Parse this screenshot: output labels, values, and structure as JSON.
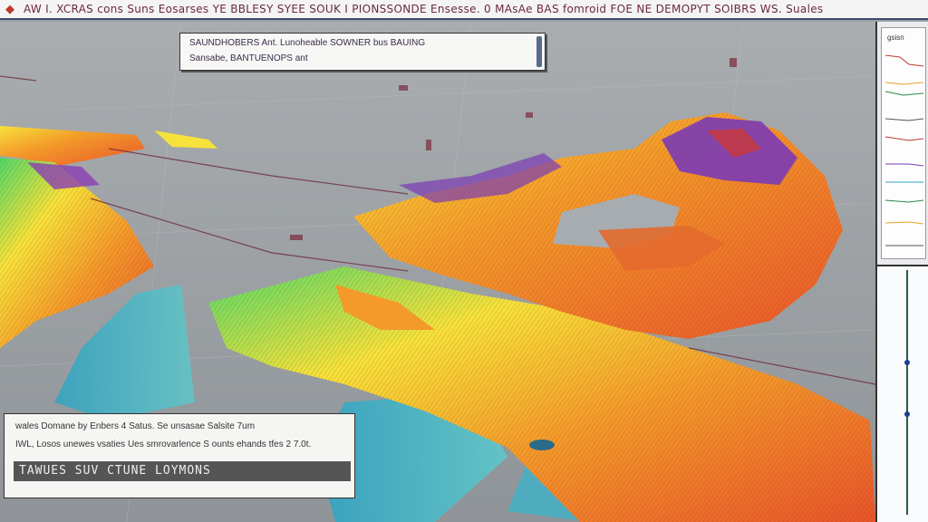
{
  "window": {
    "title": "AW I. XCRAS cons Suns Eosarses YE BBLESY SYEE SOUK I PIONSSONDE Ensesse. 0 MAsAe BAS fomroid FOE NE DEMOPYT SOIBRS WS. Suales",
    "icon": "app-logo-icon"
  },
  "info_box": {
    "line1": "SAUNDHOBERS Ant. Lunoheable SOWNER bus BAUING",
    "line2": "Sansabe, BANTUENOPS ant"
  },
  "legend_box": {
    "line1": "wales Domane by Enbers 4 Satus. Se unsasae Salsite 7um",
    "line2": "IWL, Losos unewes vsaties Ues smrovarlence S ounts ehands tfes 2 7.0t.",
    "line3": "TAWUES SUV CTUNE LOYMONS"
  },
  "side_panel": {
    "label": "gsisn"
  },
  "colors": {
    "hot": "#e8542a",
    "warm": "#f39a2a",
    "mid": "#f6e23a",
    "cool": "#4fd86a",
    "water": "#2fa3c2",
    "peak": "#7b3bb5"
  }
}
